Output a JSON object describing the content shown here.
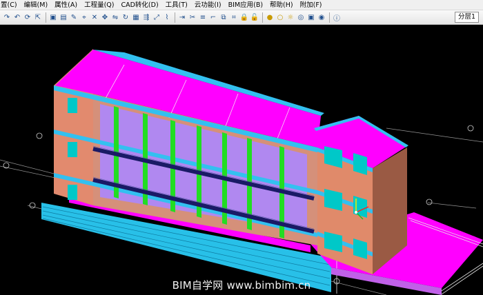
{
  "menu": [
    {
      "label": "置(C)"
    },
    {
      "label": "编辑(M)"
    },
    {
      "label": "属性(A)"
    },
    {
      "label": "工程量(Q)"
    },
    {
      "label": "CAD转化(D)"
    },
    {
      "label": "工具(T)"
    },
    {
      "label": "云功能(I)"
    },
    {
      "label": "BIM应用(B)"
    },
    {
      "label": "帮助(H)"
    },
    {
      "label": "附加(F)"
    }
  ],
  "toolbar": {
    "layer_label": "分层1",
    "icons": [
      "redo-icon",
      "undo-icon",
      "refresh-icon",
      "select-icon",
      "view-icon",
      "copy-icon",
      "paint-icon",
      "measure-icon",
      "delete-icon",
      "move-icon",
      "mirror-icon",
      "rotate-icon",
      "array-icon",
      "offset-icon",
      "stretch-icon",
      "break-icon",
      "extend-icon",
      "trim-icon",
      "align-icon",
      "corner-icon",
      "merge-icon",
      "split-icon",
      "lock-icon",
      "unlock-icon",
      "bulb-icon",
      "bulb-off-icon",
      "sun-icon",
      "orbit-icon",
      "camera-icon",
      "eye-icon",
      "info-icon"
    ]
  },
  "watermark": "BIM自学网 www.bimbim.cn",
  "colors": {
    "roof": "#ff00ff",
    "wall": "#e08a6a",
    "beam": "#33c0f0",
    "column": "#22dd22",
    "window": "#00c8c8",
    "railing": "#1a1a66",
    "background": "#000000"
  }
}
